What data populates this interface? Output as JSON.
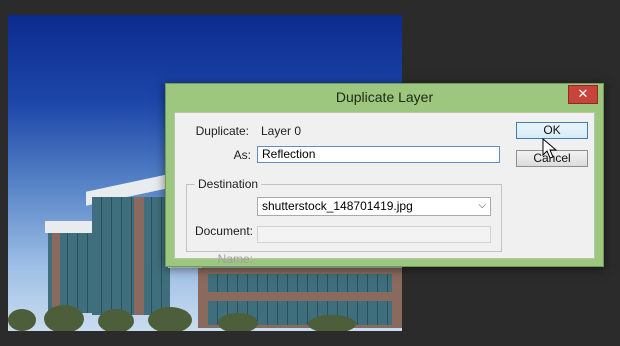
{
  "dialog": {
    "title": "Duplicate Layer",
    "close_label": "✕",
    "duplicate_label": "Duplicate:",
    "duplicate_value": "Layer 0",
    "as_label": "As:",
    "as_value": "Reflection",
    "destination_legend": "Destination",
    "document_label": "Document:",
    "document_value": "shutterstock_148701419.jpg",
    "name_label": "Name:",
    "name_value": "",
    "ok_label": "OK",
    "cancel_label": "Cancel"
  },
  "colors": {
    "titlebar": "#9dc67e",
    "close_button": "#c8433b",
    "input_focus_border": "#5b8dc9"
  },
  "icons": {
    "close": "close-icon",
    "dropdown": "chevron-down-icon",
    "cursor": "mouse-pointer-icon"
  }
}
